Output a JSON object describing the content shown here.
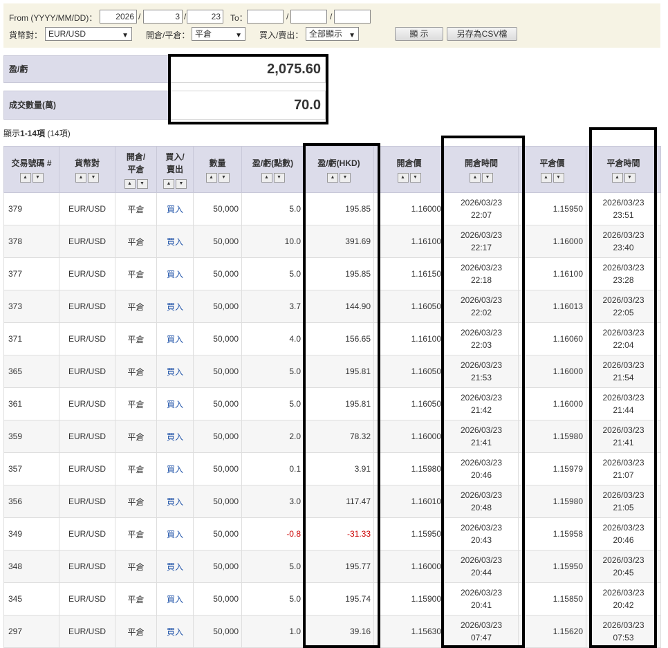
{
  "filter": {
    "from_label": "From (YYYY/MM/DD)：",
    "from_year": "2026",
    "from_month": "3",
    "from_day": "23",
    "slash": "/",
    "to_label": "To：",
    "to_year": "",
    "to_month": "",
    "to_day": "",
    "pair_label": "貨幣對：",
    "pair_value": "EUR/USD",
    "openclose_label": "開倉/平倉：",
    "openclose_value": "平倉",
    "buysell_label": "買入/賣出：",
    "buysell_value": "全部顯示",
    "show_button": "顯 示",
    "csv_button": "另存為CSV檔"
  },
  "summary": {
    "pl_label": "盈/虧",
    "pl_value": "2,075.60",
    "volume_label": "成交數量(萬)",
    "volume_value": "70.0"
  },
  "count": {
    "prefix": "顯示",
    "range": "1-14項",
    "total": " (14項)"
  },
  "table": {
    "headers": {
      "id": "交易號碼 #",
      "pair": "貨幣對",
      "oc1": "開倉/",
      "oc2": "平倉",
      "bs1": "買入/",
      "bs2": "賣出",
      "qty": "數量",
      "pts": "盈/虧(點數)",
      "hkd": "盈/虧(HKD)",
      "open_price": "開倉價",
      "open_time": "開倉時間",
      "close_price": "平倉價",
      "close_time": "平倉時間"
    },
    "rows": [
      {
        "id": "379",
        "pair": "EUR/USD",
        "oc": "平倉",
        "bs": "買入",
        "qty": "50,000",
        "pts": "5.0",
        "hkd": "195.85",
        "op": "1.16000",
        "od": "2026/03/23",
        "ot": "22:07",
        "cp": "1.15950",
        "cd": "2026/03/23",
        "ct": "23:51"
      },
      {
        "id": "378",
        "pair": "EUR/USD",
        "oc": "平倉",
        "bs": "買入",
        "qty": "50,000",
        "pts": "10.0",
        "hkd": "391.69",
        "op": "1.16100",
        "od": "2026/03/23",
        "ot": "22:17",
        "cp": "1.16000",
        "cd": "2026/03/23",
        "ct": "23:40"
      },
      {
        "id": "377",
        "pair": "EUR/USD",
        "oc": "平倉",
        "bs": "買入",
        "qty": "50,000",
        "pts": "5.0",
        "hkd": "195.85",
        "op": "1.16150",
        "od": "2026/03/23",
        "ot": "22:18",
        "cp": "1.16100",
        "cd": "2026/03/23",
        "ct": "23:28"
      },
      {
        "id": "373",
        "pair": "EUR/USD",
        "oc": "平倉",
        "bs": "買入",
        "qty": "50,000",
        "pts": "3.7",
        "hkd": "144.90",
        "op": "1.16050",
        "od": "2026/03/23",
        "ot": "22:02",
        "cp": "1.16013",
        "cd": "2026/03/23",
        "ct": "22:05"
      },
      {
        "id": "371",
        "pair": "EUR/USD",
        "oc": "平倉",
        "bs": "買入",
        "qty": "50,000",
        "pts": "4.0",
        "hkd": "156.65",
        "op": "1.16100",
        "od": "2026/03/23",
        "ot": "22:03",
        "cp": "1.16060",
        "cd": "2026/03/23",
        "ct": "22:04"
      },
      {
        "id": "365",
        "pair": "EUR/USD",
        "oc": "平倉",
        "bs": "買入",
        "qty": "50,000",
        "pts": "5.0",
        "hkd": "195.81",
        "op": "1.16050",
        "od": "2026/03/23",
        "ot": "21:53",
        "cp": "1.16000",
        "cd": "2026/03/23",
        "ct": "21:54"
      },
      {
        "id": "361",
        "pair": "EUR/USD",
        "oc": "平倉",
        "bs": "買入",
        "qty": "50,000",
        "pts": "5.0",
        "hkd": "195.81",
        "op": "1.16050",
        "od": "2026/03/23",
        "ot": "21:42",
        "cp": "1.16000",
        "cd": "2026/03/23",
        "ct": "21:44"
      },
      {
        "id": "359",
        "pair": "EUR/USD",
        "oc": "平倉",
        "bs": "買入",
        "qty": "50,000",
        "pts": "2.0",
        "hkd": "78.32",
        "op": "1.16000",
        "od": "2026/03/23",
        "ot": "21:41",
        "cp": "1.15980",
        "cd": "2026/03/23",
        "ct": "21:41"
      },
      {
        "id": "357",
        "pair": "EUR/USD",
        "oc": "平倉",
        "bs": "買入",
        "qty": "50,000",
        "pts": "0.1",
        "hkd": "3.91",
        "op": "1.15980",
        "od": "2026/03/23",
        "ot": "20:46",
        "cp": "1.15979",
        "cd": "2026/03/23",
        "ct": "21:07"
      },
      {
        "id": "356",
        "pair": "EUR/USD",
        "oc": "平倉",
        "bs": "買入",
        "qty": "50,000",
        "pts": "3.0",
        "hkd": "117.47",
        "op": "1.16010",
        "od": "2026/03/23",
        "ot": "20:48",
        "cp": "1.15980",
        "cd": "2026/03/23",
        "ct": "21:05"
      },
      {
        "id": "349",
        "pair": "EUR/USD",
        "oc": "平倉",
        "bs": "買入",
        "qty": "50,000",
        "pts": "-0.8",
        "hkd": "-31.33",
        "op": "1.15950",
        "od": "2026/03/23",
        "ot": "20:43",
        "cp": "1.15958",
        "cd": "2026/03/23",
        "ct": "20:46"
      },
      {
        "id": "348",
        "pair": "EUR/USD",
        "oc": "平倉",
        "bs": "買入",
        "qty": "50,000",
        "pts": "5.0",
        "hkd": "195.77",
        "op": "1.16000",
        "od": "2026/03/23",
        "ot": "20:44",
        "cp": "1.15950",
        "cd": "2026/03/23",
        "ct": "20:45"
      },
      {
        "id": "345",
        "pair": "EUR/USD",
        "oc": "平倉",
        "bs": "買入",
        "qty": "50,000",
        "pts": "5.0",
        "hkd": "195.74",
        "op": "1.15900",
        "od": "2026/03/23",
        "ot": "20:41",
        "cp": "1.15850",
        "cd": "2026/03/23",
        "ct": "20:42"
      },
      {
        "id": "297",
        "pair": "EUR/USD",
        "oc": "平倉",
        "bs": "買入",
        "qty": "50,000",
        "pts": "1.0",
        "hkd": "39.16",
        "op": "1.15630",
        "od": "2026/03/23",
        "ot": "07:47",
        "cp": "1.15620",
        "cd": "2026/03/23",
        "ct": "07:53"
      }
    ]
  },
  "colors": {
    "header_bg": "#dcdcea",
    "filter_bg": "#f6f3e4",
    "buy": "#2255aa",
    "negative": "#cc0000"
  }
}
